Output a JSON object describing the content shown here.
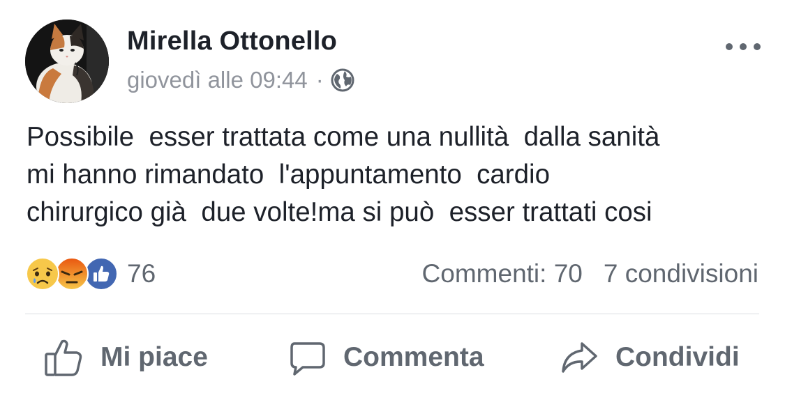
{
  "post": {
    "author": "Mirella Ottonello",
    "timestamp": "giovedì alle 09:44",
    "separator": "·",
    "privacy_icon": "globe-icon",
    "more_icon": "more-options-icon",
    "text": "Possibile  esser trattata come una nullità  dalla sanità\nmi hanno rimandato  l'appuntamento  cardio\nchirurgico già  due volte!ma si può  esser trattati cosi"
  },
  "reactions": {
    "types": [
      "sad",
      "angry",
      "like"
    ],
    "count": "76"
  },
  "stats": {
    "comments": "Commenti: 70",
    "shares": "7 condivisioni"
  },
  "actions": {
    "like": "Mi piace",
    "comment": "Commenta",
    "share": "Condividi"
  },
  "colors": {
    "text": "#1d2129",
    "secondary": "#606770",
    "timestamp": "#90949c",
    "like_blue": "#4267b2",
    "reaction_yellow": "#f7c84a",
    "angry_red": "#e9710f",
    "divider": "#dadde1"
  }
}
